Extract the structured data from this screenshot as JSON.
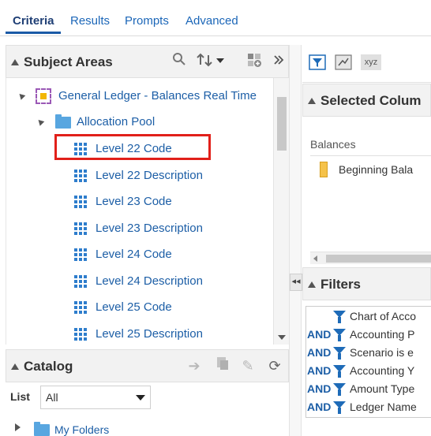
{
  "tabs": [
    "Criteria",
    "Results",
    "Prompts",
    "Advanced"
  ],
  "subject_areas": {
    "title": "Subject Areas",
    "icons": [
      "search-icon",
      "sort-icon",
      "add-subject-area-icon",
      "collapse-panel-icon"
    ],
    "tree": [
      {
        "label": "General Ledger - Balances Real Time",
        "type": "subject-area",
        "level": 0
      },
      {
        "label": "Allocation Pool",
        "type": "folder",
        "level": 1
      },
      {
        "label": "Level 22 Code",
        "type": "column",
        "level": 2,
        "selected": true
      },
      {
        "label": "Level 22 Description",
        "type": "column",
        "level": 2
      },
      {
        "label": "Level 23 Code",
        "type": "column",
        "level": 2
      },
      {
        "label": "Level 23 Description",
        "type": "column",
        "level": 2
      },
      {
        "label": "Level 24 Code",
        "type": "column",
        "level": 2
      },
      {
        "label": "Level 24 Description",
        "type": "column",
        "level": 2
      },
      {
        "label": "Level 25 Code",
        "type": "column",
        "level": 2
      },
      {
        "label": "Level 25 Description",
        "type": "column",
        "level": 2
      }
    ]
  },
  "catalog": {
    "title": "Catalog",
    "list_label": "List",
    "list_value": "All",
    "folder": "My Folders"
  },
  "toolbar_right": {
    "filter_icon": "filter-icon",
    "xyz_label": "xyz"
  },
  "selected_columns": {
    "title": "Selected Colum",
    "group": "Balances",
    "column": "Beginning Bala"
  },
  "filters": {
    "title": "Filters",
    "rows": [
      {
        "op": "",
        "text": "Chart of Acco"
      },
      {
        "op": "AND",
        "text": "Accounting P"
      },
      {
        "op": "AND",
        "text": "Scenario is e"
      },
      {
        "op": "AND",
        "text": "Accounting Y"
      },
      {
        "op": "AND",
        "text": "Amount Type"
      },
      {
        "op": "AND",
        "text": "Ledger Name"
      }
    ]
  },
  "colors": {
    "accent": "#1c5ea6",
    "highlight_border": "#e1201a"
  }
}
